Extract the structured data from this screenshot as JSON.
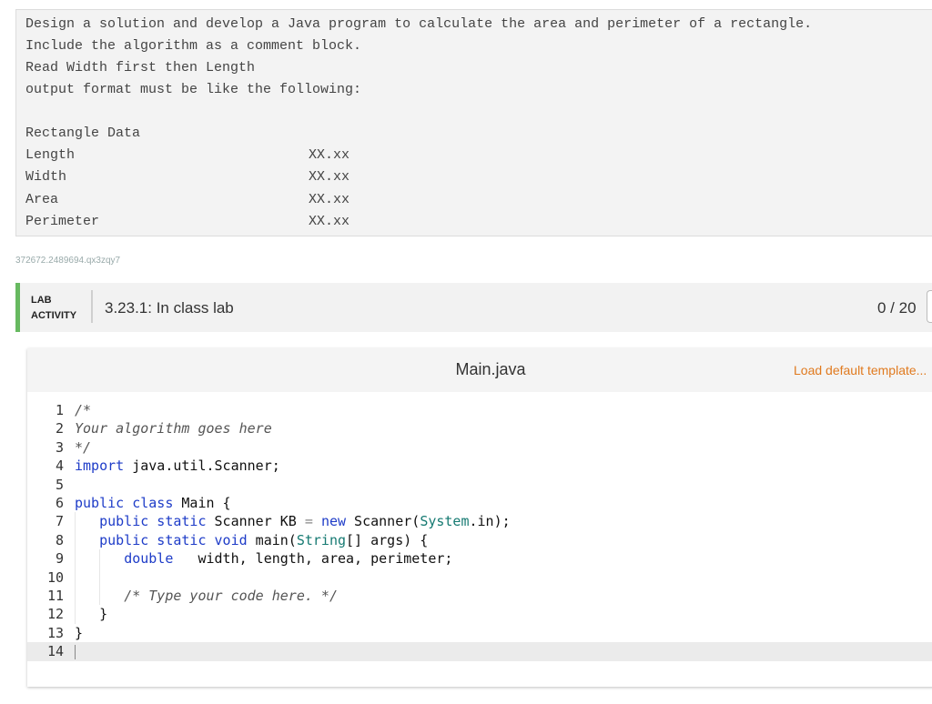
{
  "prompt": {
    "lines": [
      "Design a solution and develop a Java program to calculate the area and perimeter of a rectangle.",
      "Include the algorithm as a comment block.",
      "Read Width first then Length",
      "output format must be like the following:"
    ],
    "table_title": "Rectangle Data",
    "table_rows": [
      {
        "label": "Length",
        "value": "XX.xx"
      },
      {
        "label": "Width",
        "value": "XX.xx"
      },
      {
        "label": "Area",
        "value": "XX.xx"
      },
      {
        "label": "Perimeter",
        "value": "XX.xx"
      }
    ]
  },
  "watermark": "372672.2489694.qx3zqy7",
  "lab": {
    "type_line1": "LAB",
    "type_line2": "ACTIVITY",
    "title": "3.23.1: In class lab",
    "score": "0 / 20"
  },
  "editor": {
    "file_name": "Main.java",
    "load_template": "Load default template...",
    "line_numbers": [
      "1",
      "2",
      "3",
      "4",
      "5",
      "6",
      "7",
      "8",
      "9",
      "10",
      "11",
      "12",
      "13",
      "14"
    ],
    "colors": {
      "keyword": "#1e3cc8",
      "type": "#167a72",
      "comment": "#555555",
      "load_link": "#e07a1f",
      "lab_accent": "#67b960"
    }
  }
}
